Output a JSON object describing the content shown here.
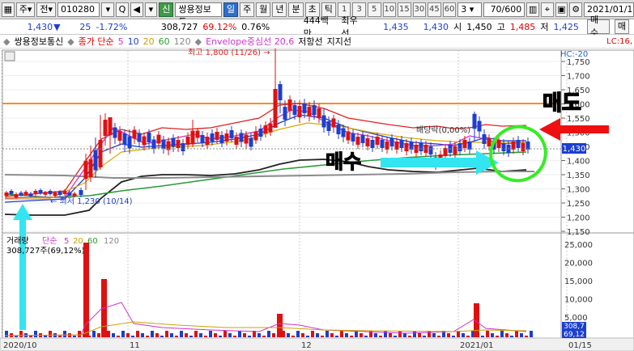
{
  "toolbar": {
    "market_label": "주",
    "view_label": "전",
    "code": "010280",
    "search_btn": "Q",
    "badge_new": "신",
    "stock_name": "쌍용정보통",
    "period_day": "일",
    "period_week": "주",
    "period_month": "월",
    "period_year": "년",
    "period_min": "분",
    "period_sec": "초",
    "period_tick": "틱",
    "intervals": [
      "1",
      "3",
      "5",
      "10",
      "15",
      "30",
      "45",
      "60"
    ],
    "interval_select": "3",
    "page_counter": "70/600",
    "date": "2021/01/1"
  },
  "quote": {
    "price": "1,430",
    "change": "25",
    "change_pct": "-1.72%",
    "volume": "308,727",
    "volume_pct": "69.12%",
    "turnover": "0.76%",
    "amount": "444백만",
    "best_ask_label": "최우선",
    "best_ask": "1,435",
    "best_bid": "1,430",
    "open_label": "시",
    "open": "1,450",
    "high_label": "고",
    "high": "1,485",
    "low_label": "저",
    "low": "1,425",
    "buy_label": "매수",
    "sell_label": "매"
  },
  "legend": {
    "name": "쌍용정보통신",
    "ma_label": "종가 단순",
    "ma_periods": [
      "5",
      "10",
      "20",
      "60",
      "120"
    ],
    "envelope": "Envelope중심선 20,6",
    "resistance": "저항선",
    "support": "지지선",
    "lc": "LC:16,",
    "hc": "HC:-20"
  },
  "price_axis": [
    "1,750",
    "1,700",
    "1,650",
    "1,600",
    "1,550",
    "1,500",
    "1,450",
    "1,400",
    "1,350",
    "1,300",
    "1,250",
    "1,200",
    "1,150"
  ],
  "current_price_tag": "1,430",
  "annotations": {
    "high": "최고 1,800 (11/26) →",
    "low": "← 최저 1,230 (10/14)",
    "dividend": "배당락(0,00%)",
    "buy": "매수",
    "sell": "매도"
  },
  "volume_panel": {
    "title": "거래량",
    "ma_label": "단순",
    "ma_periods": [
      "5",
      "20",
      "60",
      "120"
    ],
    "current": "308,727주(69,12%)",
    "axis": [
      "25,000",
      "20,000",
      "15,000",
      "10,000",
      "5,000"
    ],
    "tag1": "308,7",
    "tag2": "69,12"
  },
  "date_axis": [
    "2020/10",
    "11",
    "12",
    "2021/01",
    "01/15"
  ],
  "colors": {
    "up": "#e01010",
    "down": "#1c3fd0",
    "resistance": "#ff8c1a",
    "annotation_arrow": "#33e5f0",
    "circle": "#33ee22"
  }
}
